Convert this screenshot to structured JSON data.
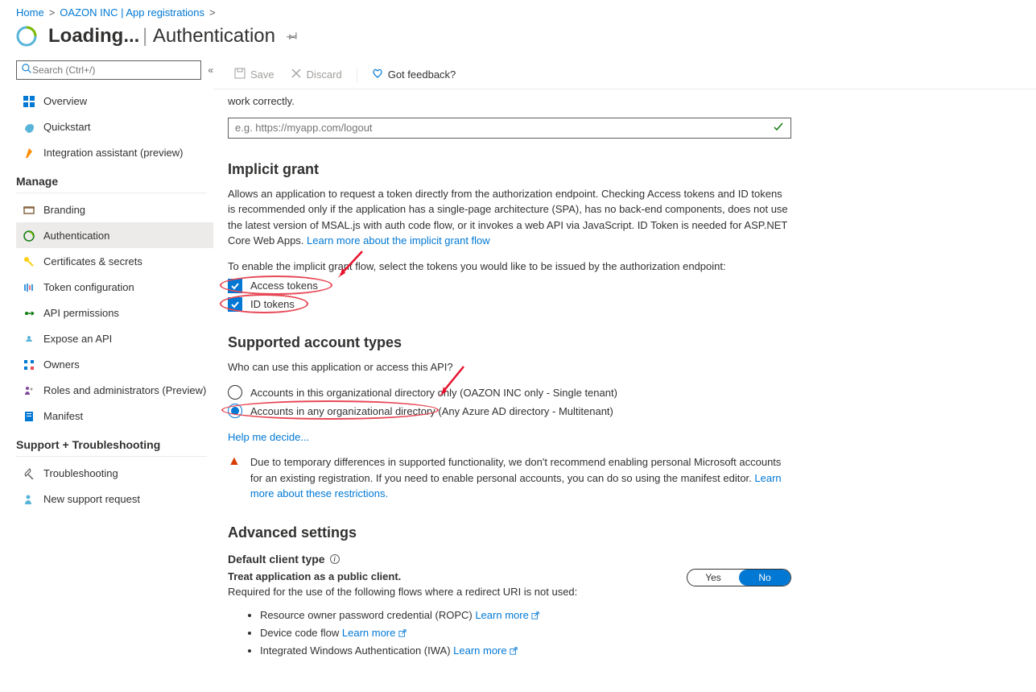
{
  "breadcrumb": {
    "home": "Home",
    "item1": "OAZON INC | App registrations"
  },
  "header": {
    "title": "Loading...",
    "sub": "Authentication"
  },
  "search": {
    "placeholder": "Search (Ctrl+/)"
  },
  "nav": {
    "overview": "Overview",
    "quickstart": "Quickstart",
    "integration": "Integration assistant (preview)",
    "manage": "Manage",
    "branding": "Branding",
    "authentication": "Authentication",
    "certs": "Certificates & secrets",
    "token": "Token configuration",
    "api_perm": "API permissions",
    "expose": "Expose an API",
    "owners": "Owners",
    "roles": "Roles and administrators (Preview)",
    "manifest": "Manifest",
    "support": "Support + Troubleshooting",
    "troubleshoot": "Troubleshooting",
    "newreq": "New support request"
  },
  "toolbar": {
    "save": "Save",
    "discard": "Discard",
    "feedback": "Got feedback?"
  },
  "logout": {
    "desc_tail": "work correctly.",
    "placeholder": "e.g. https://myapp.com/logout"
  },
  "implicit": {
    "title": "Implicit grant",
    "desc": "Allows an application to request a token directly from the authorization endpoint. Checking Access tokens and ID tokens is recommended only if the application has a single-page architecture (SPA), has no back-end components, does not use the latest version of MSAL.js with auth code flow, or it invokes a web API via JavaScript. ID Token is needed for ASP.NET Core Web Apps. ",
    "learn": "Learn more about the implicit grant flow",
    "enable": "To enable the implicit grant flow, select the tokens you would like to be issued by the authorization endpoint:",
    "cb_access": "Access tokens",
    "cb_id": "ID tokens"
  },
  "supported": {
    "title": "Supported account types",
    "who": "Who can use this application or access this API?",
    "opt1": "Accounts in this organizational directory only (OAZON INC only - Single tenant)",
    "opt2": "Accounts in any organizational directory (Any Azure AD directory - Multitenant)",
    "help": "Help me decide..."
  },
  "warning": {
    "msg": "Due to temporary differences in supported functionality, we don't recommend enabling personal Microsoft accounts for an existing registration. If you need to enable personal accounts, you can do so using the manifest editor. ",
    "learn": "Learn more about these restrictions."
  },
  "advanced": {
    "title": "Advanced settings",
    "default_client": "Default client type",
    "treat_bold": "Treat application as a public client.",
    "treat_rest": "Required for the use of the following flows where a redirect URI is not used:",
    "yes": "Yes",
    "no": "No",
    "flow1": "Resource owner password credential (ROPC) ",
    "flow2": "Device code flow ",
    "flow3": "Integrated Windows Authentication (IWA) ",
    "learn": "Learn more"
  }
}
